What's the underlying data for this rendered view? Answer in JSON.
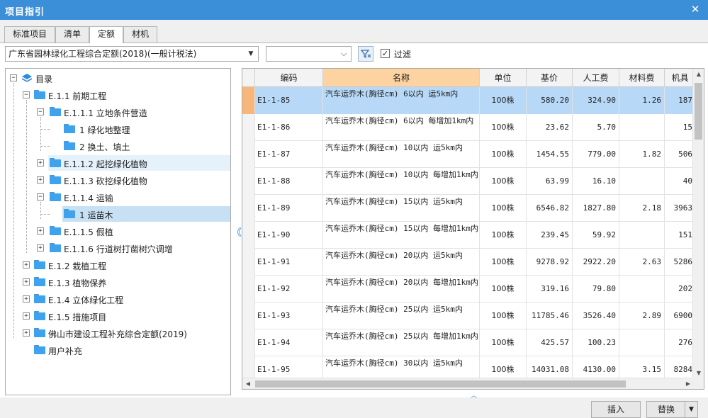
{
  "window": {
    "title": "项目指引",
    "close_glyph": "✕"
  },
  "tabs": [
    {
      "label": "标准项目",
      "active": false
    },
    {
      "label": "清单",
      "active": false
    },
    {
      "label": "定额",
      "active": true
    },
    {
      "label": "材机",
      "active": false
    }
  ],
  "toolbar": {
    "quota_select_value": "广东省园林绿化工程综合定额(2018)(一般计税法)",
    "second_select_value": "",
    "filter_label": "过滤",
    "filter_checked": true,
    "check_glyph": "✓"
  },
  "tree": {
    "nodes": [
      {
        "label": "目录",
        "level": 0,
        "expander": "−",
        "icon": "layers-icon"
      },
      {
        "label": "E.1.1 前期工程",
        "level": 1,
        "expander": "−",
        "icon": "folder-icon"
      },
      {
        "label": "E.1.1.1 立地条件营造",
        "level": 2,
        "expander": "−",
        "icon": "folder-icon"
      },
      {
        "label": "1 绿化地整理",
        "level": 3,
        "expander": "",
        "icon": "folder-icon"
      },
      {
        "label": "2 换土、填土",
        "level": 3,
        "expander": "",
        "icon": "folder-icon"
      },
      {
        "label": "E.1.1.2 起挖绿化植物",
        "level": 2,
        "expander": "+",
        "icon": "folder-icon",
        "state": "hover"
      },
      {
        "label": "E.1.1.3 砍挖绿化植物",
        "level": 2,
        "expander": "+",
        "icon": "folder-icon"
      },
      {
        "label": "E.1.1.4 运输",
        "level": 2,
        "expander": "−",
        "icon": "folder-icon"
      },
      {
        "label": "1 运苗木",
        "level": 3,
        "expander": "",
        "icon": "folder-icon",
        "state": "selected"
      },
      {
        "label": "E.1.1.5 假植",
        "level": 2,
        "expander": "+",
        "icon": "folder-icon"
      },
      {
        "label": "E.1.1.6 行道树打凿树穴调增",
        "level": 2,
        "expander": "+",
        "icon": "folder-icon"
      },
      {
        "label": "E.1.2 栽植工程",
        "level": 1,
        "expander": "+",
        "icon": "folder-icon"
      },
      {
        "label": "E.1.3 植物保养",
        "level": 1,
        "expander": "+",
        "icon": "folder-icon"
      },
      {
        "label": "E.1.4 立体绿化工程",
        "level": 1,
        "expander": "+",
        "icon": "folder-icon"
      },
      {
        "label": "E.1.5 措施项目",
        "level": 1,
        "expander": "+",
        "icon": "folder-icon"
      },
      {
        "label": "佛山市建设工程补充综合定额(2019)",
        "level": 1,
        "expander": "+",
        "icon": "folder-icon"
      },
      {
        "label": "用户补充",
        "level": 1,
        "expander": "",
        "icon": "folder-icon"
      }
    ]
  },
  "grid": {
    "columns": [
      "编码",
      "名称",
      "单位",
      "基价",
      "人工费",
      "材料费",
      "机具"
    ],
    "sorted_column": 1,
    "rows": [
      {
        "code": "E1-1-85",
        "name": "汽车运乔木(胸径cm) 6以内 运5km内",
        "unit": "100株",
        "base": "580.20",
        "labor": "324.90",
        "material": "1.26",
        "machine": "187",
        "selected": true
      },
      {
        "code": "E1-1-86",
        "name": "汽车运乔木(胸径cm) 6以内 每增加1km内",
        "unit": "100株",
        "base": "23.62",
        "labor": "5.70",
        "material": "",
        "machine": "15",
        "selected": false
      },
      {
        "code": "E1-1-87",
        "name": "汽车运乔木(胸径cm) 10以内 运5km内",
        "unit": "100株",
        "base": "1454.55",
        "labor": "779.00",
        "material": "1.82",
        "machine": "506",
        "selected": false
      },
      {
        "code": "E1-1-88",
        "name": "汽车运乔木(胸径cm) 10以内 每增加1km内",
        "unit": "100株",
        "base": "63.99",
        "labor": "16.10",
        "material": "",
        "machine": "40",
        "selected": false
      },
      {
        "code": "E1-1-89",
        "name": "汽车运乔木(胸径cm) 15以内 运5km内",
        "unit": "100株",
        "base": "6546.82",
        "labor": "1827.80",
        "material": "2.18",
        "machine": "3963",
        "selected": false
      },
      {
        "code": "E1-1-90",
        "name": "汽车运乔木(胸径cm) 15以内 每增加1km内",
        "unit": "100株",
        "base": "239.45",
        "labor": "59.92",
        "material": "",
        "machine": "151",
        "selected": false
      },
      {
        "code": "E1-1-91",
        "name": "汽车运乔木(胸径cm) 20以内 运5km内",
        "unit": "100株",
        "base": "9278.92",
        "labor": "2922.20",
        "material": "2.63",
        "machine": "5286",
        "selected": false
      },
      {
        "code": "E1-1-92",
        "name": "汽车运乔木(胸径cm) 20以内 每增加1km内",
        "unit": "100株",
        "base": "319.16",
        "labor": "79.80",
        "material": "",
        "machine": "202",
        "selected": false
      },
      {
        "code": "E1-1-93",
        "name": "汽车运乔木(胸径cm) 25以内 运5km内",
        "unit": "100株",
        "base": "11785.46",
        "labor": "3526.40",
        "material": "2.89",
        "machine": "6900",
        "selected": false
      },
      {
        "code": "E1-1-94",
        "name": "汽车运乔木(胸径cm) 25以内 每增加1km内",
        "unit": "100株",
        "base": "425.57",
        "labor": "100.23",
        "material": "",
        "machine": "276",
        "selected": false
      },
      {
        "code": "E1-1-95",
        "name": "汽车运乔木(胸径cm) 30以内 运5km内",
        "unit": "100株",
        "base": "14031.08",
        "labor": "4130.00",
        "material": "3.15",
        "machine": "8284",
        "selected": false
      }
    ]
  },
  "buttons": {
    "insert": "插入",
    "replace": "替换",
    "dropdown_glyph": "▼"
  },
  "glyphs": {
    "collapse_left": "《",
    "scroll_up": "▲",
    "scroll_down": "▼",
    "scroll_left": "◀",
    "scroll_right": "▶",
    "grip_up": "︿"
  },
  "colors": {
    "title_bar": "#3b8fd8",
    "selected_row": "#b7d9f7",
    "sorted_header": "#fdd3a2",
    "selected_tree_node": "#c7e0f4",
    "folder": "#3ea3ec"
  }
}
